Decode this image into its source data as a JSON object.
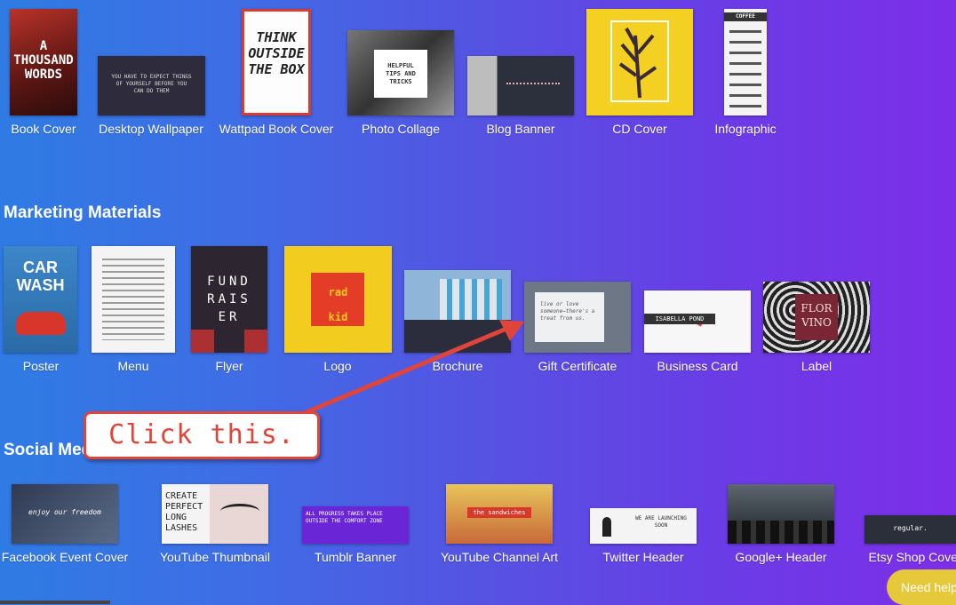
{
  "row1": [
    {
      "label": "Book Cover",
      "thumb_text": "A THOUSAND WORDS"
    },
    {
      "label": "Desktop Wallpaper",
      "thumb_text": "YOU HAVE TO EXPECT THINGS OF YOURSELF BEFORE YOU CAN DO THEM"
    },
    {
      "label": "Wattpad Book Cover",
      "thumb_text": "THINK OUTSIDE THE BOX"
    },
    {
      "label": "Photo Collage",
      "thumb_text": "HELPFUL TIPS AND TRICKS"
    },
    {
      "label": "Blog Banner",
      "thumb_text": ""
    },
    {
      "label": "CD Cover",
      "thumb_text": ""
    },
    {
      "label": "Infographic",
      "thumb_text": "COFFEE"
    }
  ],
  "marketing": {
    "title": "Marketing Materials",
    "items": [
      {
        "label": "Poster",
        "thumb_text": "CAR WASH"
      },
      {
        "label": "Menu",
        "thumb_text": ""
      },
      {
        "label": "Flyer",
        "thumb_text": "FUND RAIS ER"
      },
      {
        "label": "Logo",
        "thumb_text": "rad kid"
      },
      {
        "label": "Brochure",
        "thumb_text": ""
      },
      {
        "label": "Gift Certificate",
        "thumb_text": "live or love someone—there's a treat from us."
      },
      {
        "label": "Business Card",
        "thumb_text": "ISABELLA POND"
      },
      {
        "label": "Label",
        "thumb_text": "FLOR VINO"
      }
    ]
  },
  "social": {
    "title": "Social Media",
    "items": [
      {
        "label": "Facebook Event Cover",
        "thumb_text": "enjoy our freedom"
      },
      {
        "label": "YouTube Thumbnail",
        "thumb_text": "CREATE PERFECT LONG LASHES"
      },
      {
        "label": "Tumblr Banner",
        "thumb_text": "ALL PROGRESS TAKES PLACE OUTSIDE THE COMFORT ZONE"
      },
      {
        "label": "YouTube Channel Art",
        "thumb_text": "the sandwiches"
      },
      {
        "label": "Twitter Header",
        "thumb_text": "WE ARE LAUNCHING SOON"
      },
      {
        "label": "Google+ Header",
        "thumb_text": ""
      },
      {
        "label": "Etsy Shop Cover",
        "thumb_text": "regular."
      }
    ]
  },
  "callout": {
    "text": "Click this."
  },
  "help": {
    "label": "Need help?"
  }
}
